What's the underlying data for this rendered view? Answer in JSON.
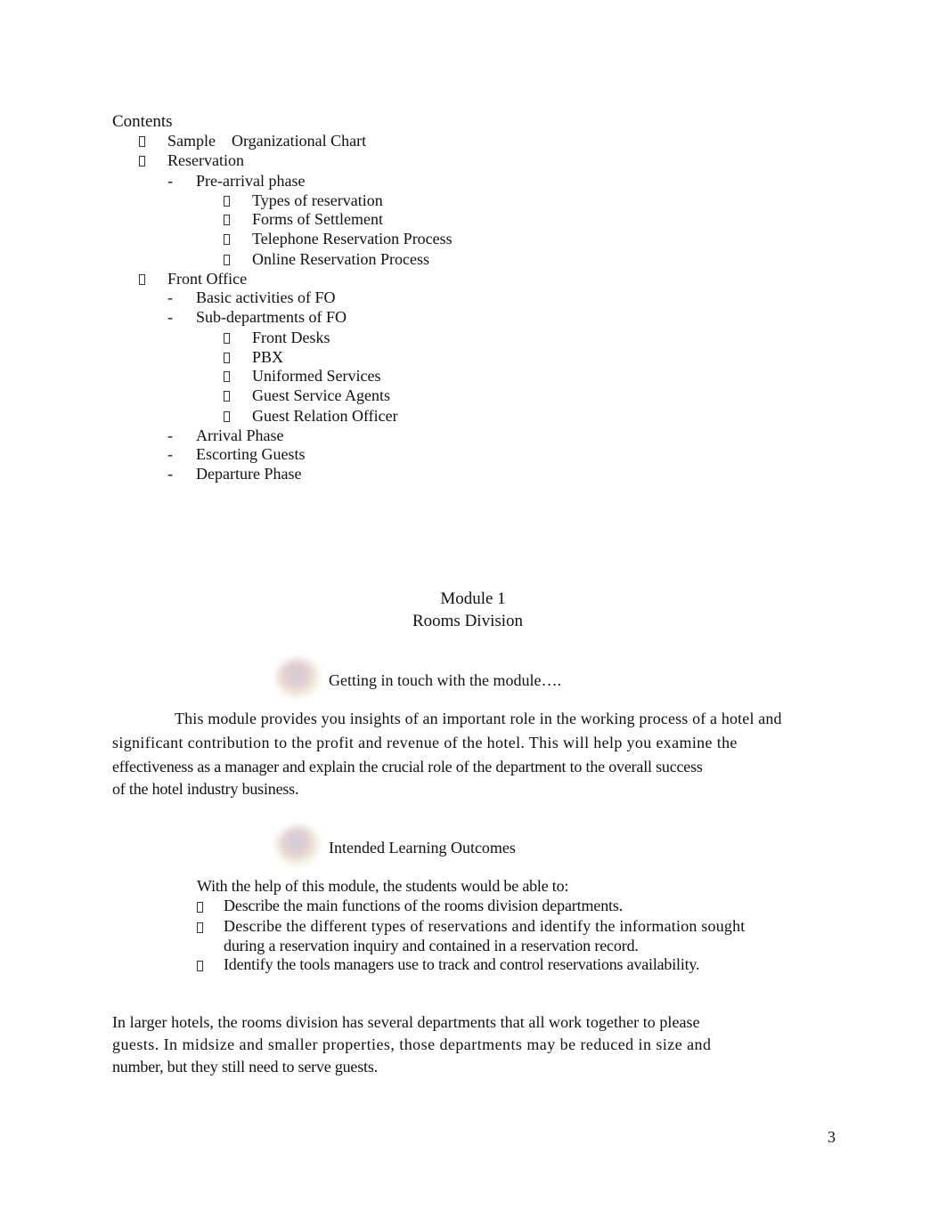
{
  "contents": {
    "heading": "Contents",
    "items": [
      {
        "level": 1,
        "marker": "bullet",
        "text": "Sample    Organizational Chart"
      },
      {
        "level": 1,
        "marker": "bullet",
        "text": "Reservation"
      },
      {
        "level": 2,
        "marker": "dash",
        "text": "Pre-arrival phase"
      },
      {
        "level": 3,
        "marker": "bullet",
        "text": "Types of reservation"
      },
      {
        "level": 3,
        "marker": "bullet",
        "text": "Forms of Settlement"
      },
      {
        "level": 3,
        "marker": "bullet",
        "text": "Telephone Reservation Process"
      },
      {
        "level": 3,
        "marker": "bullet",
        "text": "Online Reservation Process"
      },
      {
        "level": 1,
        "marker": "bullet",
        "text": "Front Office"
      },
      {
        "level": 2,
        "marker": "dash",
        "text": "Basic activities of FO"
      },
      {
        "level": 2,
        "marker": "dash",
        "text": "Sub-departments of FO"
      },
      {
        "level": 3,
        "marker": "bullet",
        "text": "Front Desks"
      },
      {
        "level": 3,
        "marker": "bullet",
        "text": "PBX"
      },
      {
        "level": 3,
        "marker": "bullet",
        "text": "Uniformed Services"
      },
      {
        "level": 3,
        "marker": "bullet",
        "text": "Guest Service Agents"
      },
      {
        "level": 3,
        "marker": "bullet",
        "text": "Guest Relation Officer"
      },
      {
        "level": 2,
        "marker": "dash",
        "text": "Arrival Phase"
      },
      {
        "level": 2,
        "marker": "dash",
        "text": "Escorting Guests"
      },
      {
        "level": 2,
        "marker": "dash",
        "text": "Departure Phase"
      }
    ]
  },
  "module": {
    "number": "Module 1",
    "title": "Rooms Division"
  },
  "intro": {
    "heading": "Getting in touch with the module….",
    "icon": "colorful-blob-icon",
    "lines": [
      "This module provides you insights of an important role in the working process of a hotel and",
      "significant contribution to the profit and revenue of the hotel.     This will help you examine the",
      "effectiveness as a manager and explain the crucial role of the department to the overall success",
      "of the hotel industry business."
    ]
  },
  "outcomes": {
    "heading": "Intended Learning Outcomes",
    "icon": "colorful-blob-icon",
    "lead": "With the help of this module, the students would be able to:",
    "items": [
      {
        "lines": [
          "Describe the main functions of the rooms division departments."
        ]
      },
      {
        "lines": [
          "Describe the different types of reservations and identify the information sought",
          "during a reservation inquiry and contained in a reservation record."
        ]
      },
      {
        "lines": [
          "Identify the tools managers use to track and control reservations availability."
        ]
      }
    ]
  },
  "closing": {
    "lines": [
      "In larger hotels, the rooms division has several departments that all work together to please",
      "guests. In midsize and smaller properties, those departments may be reduced in size and",
      "number, but they still need to serve guests."
    ]
  },
  "page_number": "3"
}
